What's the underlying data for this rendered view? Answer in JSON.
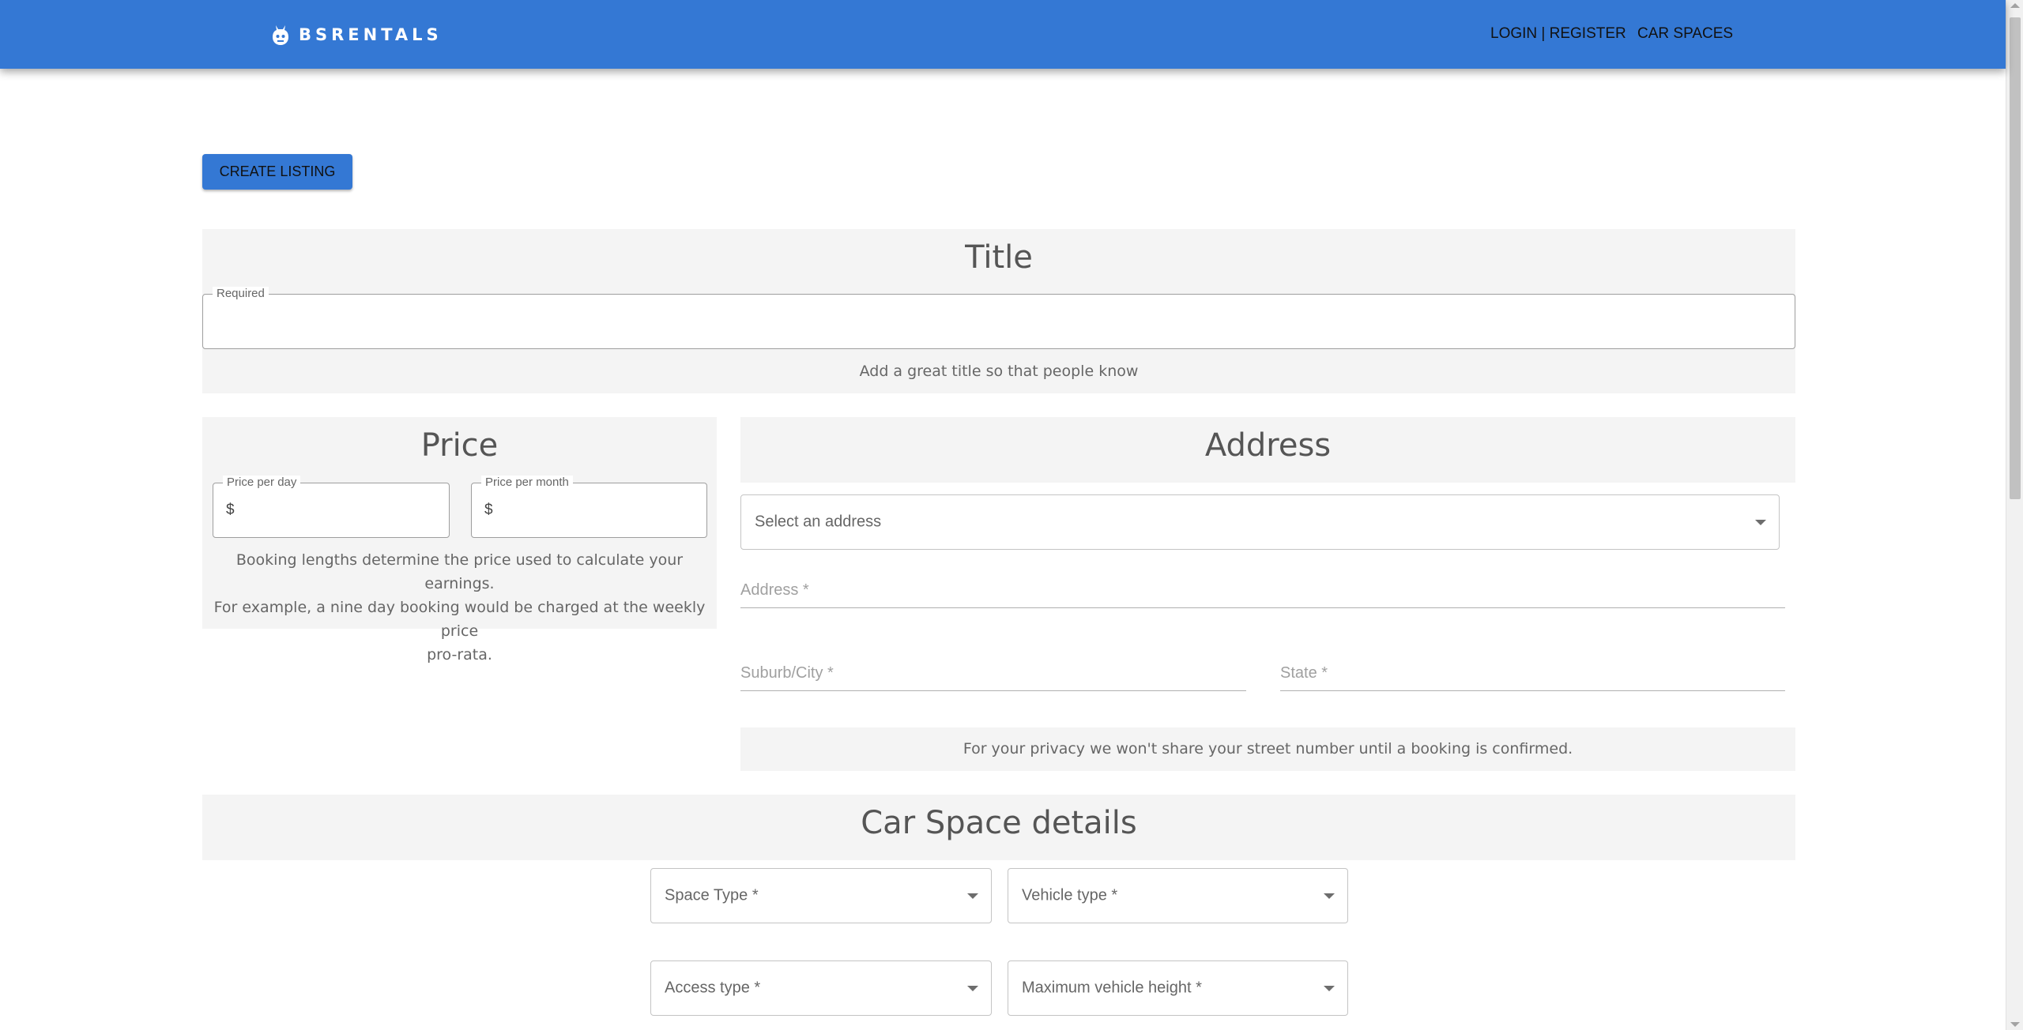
{
  "header": {
    "brand": "BSRENTALS",
    "brand_icon": "robot-head-icon",
    "nav": {
      "login_register": "LOGIN | REGISTER",
      "car_spaces": "CAR SPACES"
    },
    "color": "#3478d4"
  },
  "actions": {
    "create_listing": "CREATE LISTING"
  },
  "title_section": {
    "heading": "Title",
    "field_label": "Required",
    "value": "",
    "helper": "Add a great title so that people know"
  },
  "price_section": {
    "heading": "Price",
    "per_day": {
      "label": "Price per day",
      "prefix": "$",
      "value": ""
    },
    "per_month": {
      "label": "Price per month",
      "prefix": "$",
      "value": ""
    },
    "helper_lines": [
      "Booking lengths determine the price used to calculate your earnings.",
      "For example, a nine day booking would be charged at the weekly price",
      "pro-rata."
    ]
  },
  "address_section": {
    "heading": "Address",
    "select_placeholder": "Select an address",
    "address_label": "Address *",
    "suburb_label": "Suburb/City *",
    "state_label": "State *",
    "privacy_note": "For your privacy we won't share your street number until a booking is confirmed."
  },
  "details_section": {
    "heading": "Car Space details",
    "space_type": "Space Type *",
    "vehicle_type": "Vehicle type *",
    "access_type": "Access type *",
    "max_height": "Maximum vehicle height *"
  }
}
